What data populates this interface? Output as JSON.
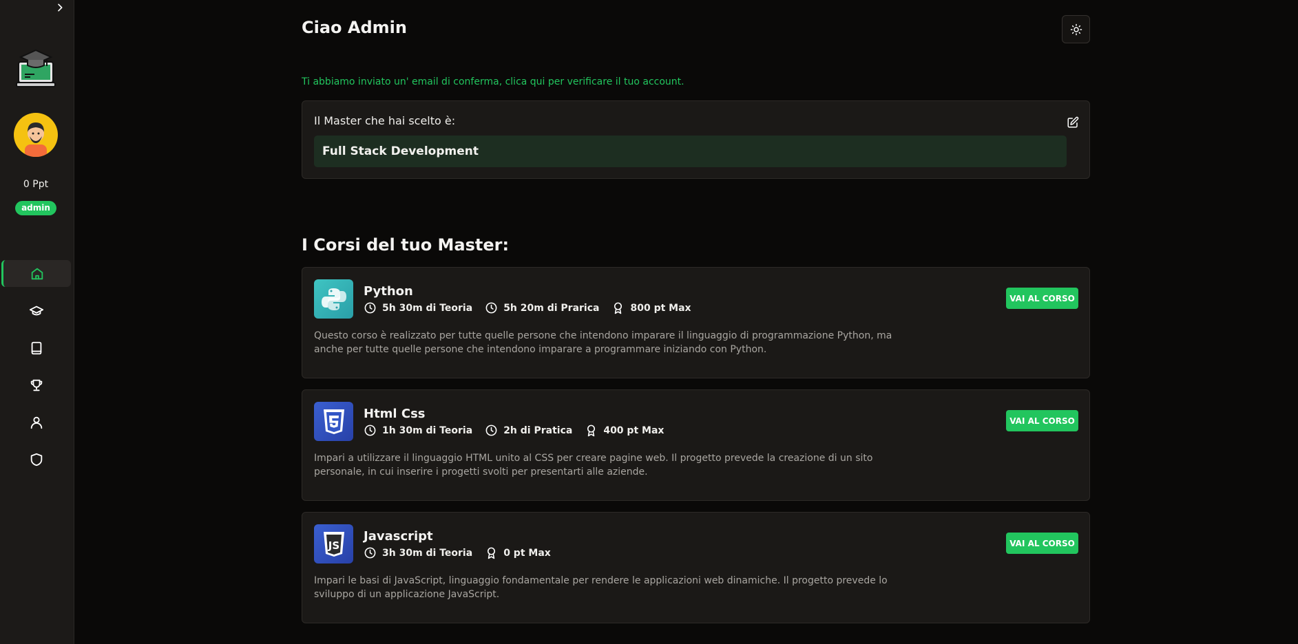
{
  "user": {
    "greeting": "Ciao Admin",
    "points": "0 Ppt",
    "role": "admin"
  },
  "notice": "Ti abbiamo inviato un' email di conferma, clica qui per verificare il tuo account.",
  "master": {
    "label": "Il Master che hai scelto è:",
    "value": "Full Stack Development"
  },
  "courses_title": "I Corsi del tuo Master:",
  "courses": [
    {
      "name": "Python",
      "theory": "5h 30m di Teoria",
      "practice": "5h 20m di Prarica",
      "points": "800 pt Max",
      "description": "Questo corso è realizzato per tutte quelle persone che intendono imparare il linguaggio di programmazione Python, ma anche per tutte quelle persone che intendono imparare a programmare iniziando con Python.",
      "button": "VAI AL CORSO",
      "icon": "python-icon"
    },
    {
      "name": "Html Css",
      "theory": "1h 30m di Teoria",
      "practice": "2h di Pratica",
      "points": "400 pt Max",
      "description": "Impari a utilizzare il linguaggio HTML unito al CSS per creare pagine web. Il progetto prevede la creazione di un sito personale, in cui inserire i progetti svolti per presentarti alle aziende.",
      "button": "VAI AL CORSO",
      "icon": "html5-icon"
    },
    {
      "name": "Javascript",
      "theory": "3h 30m di Teoria",
      "points": "0 pt Max",
      "description": "Impari le basi di JavaScript, linguaggio fondamentale per rendere le applicazioni web dinamiche. Il progetto prevede lo sviluppo di un applicazione JavaScript.",
      "button": "VAI AL CORSO",
      "icon": "javascript-icon"
    }
  ],
  "colors": {
    "accent": "#22c55e",
    "background": "#0a0908",
    "sidebar": "#1c1a18",
    "card": "#1b1917"
  },
  "sidebar_icons": [
    "home-icon",
    "graduation-cap-icon",
    "book-icon",
    "trophy-icon",
    "user-icon",
    "shield-icon"
  ]
}
